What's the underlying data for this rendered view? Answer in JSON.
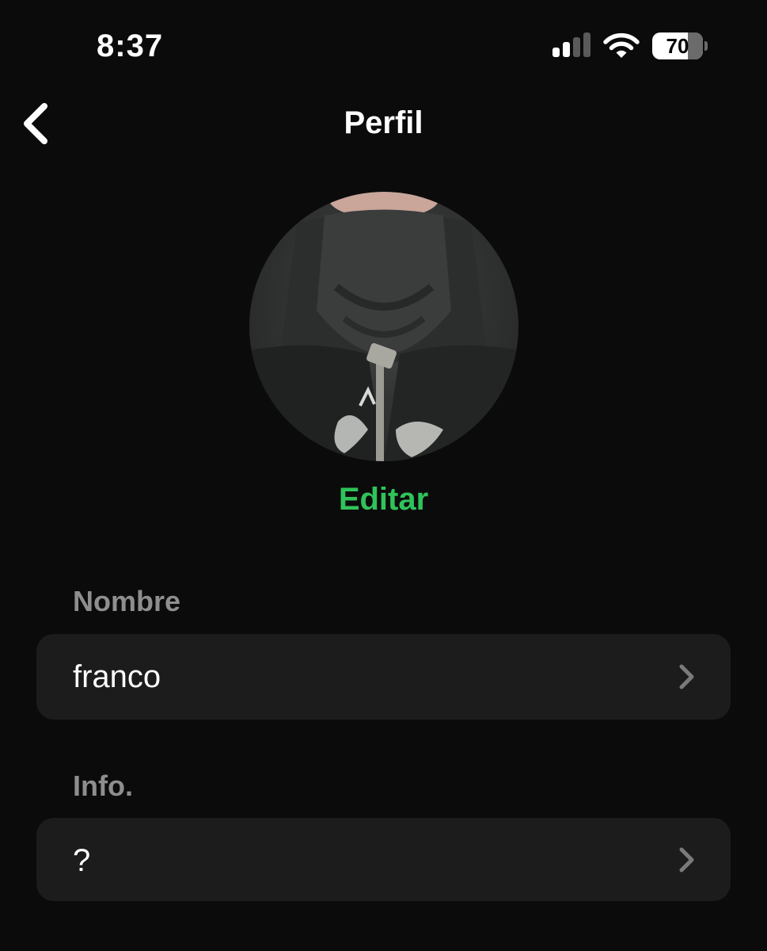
{
  "status_bar": {
    "time": "8:37",
    "battery_percent": "70"
  },
  "nav": {
    "title": "Perfil",
    "back_icon": "chevron-left-icon"
  },
  "profile": {
    "edit_label": "Editar"
  },
  "fields": [
    {
      "label": "Nombre",
      "value": "franco"
    },
    {
      "label": "Info.",
      "value": "?"
    }
  ],
  "colors": {
    "background": "#0b0b0b",
    "row_background": "#1c1c1c",
    "accent": "#2fc35a",
    "label_gray": "#8e8e8e"
  }
}
